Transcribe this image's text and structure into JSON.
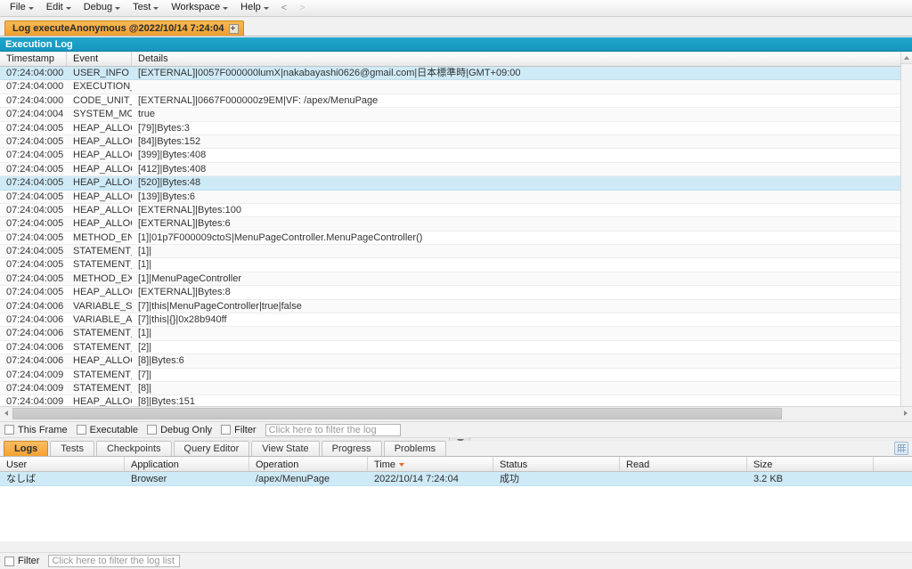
{
  "menubar": {
    "items": [
      {
        "label": "File",
        "caret": true
      },
      {
        "label": "Edit",
        "caret": true
      },
      {
        "label": "Debug",
        "caret": true
      },
      {
        "label": "Test",
        "caret": true
      },
      {
        "label": "Workspace",
        "caret": true
      },
      {
        "label": "Help",
        "caret": true
      }
    ],
    "nav_back": "<",
    "nav_forward": ">"
  },
  "doctab": {
    "label": "Log executeAnonymous @2022/10/14 7:24:04",
    "close_title": "Close"
  },
  "exec_panel": {
    "title": "Execution Log"
  },
  "log_grid": {
    "columns": [
      "Timestamp",
      "Event",
      "Details"
    ],
    "rows": [
      {
        "ts": "07:24:04:000",
        "ev": "USER_INFO",
        "de": "[EXTERNAL]|0057F000000lumX|nakabayashi0626@gmail.com|日本標準時|GMT+09:00",
        "sel": true
      },
      {
        "ts": "07:24:04:000",
        "ev": "EXECUTION_ST...",
        "de": ""
      },
      {
        "ts": "07:24:04:000",
        "ev": "CODE_UNIT_ST...",
        "de": "[EXTERNAL]|0667F000000z9EM|VF: /apex/MenuPage"
      },
      {
        "ts": "07:24:04:004",
        "ev": "SYSTEM_MODE...",
        "de": "true"
      },
      {
        "ts": "07:24:04:005",
        "ev": "HEAP_ALLOCATE",
        "de": "[79]|Bytes:3"
      },
      {
        "ts": "07:24:04:005",
        "ev": "HEAP_ALLOCATE",
        "de": "[84]|Bytes:152"
      },
      {
        "ts": "07:24:04:005",
        "ev": "HEAP_ALLOCATE",
        "de": "[399]|Bytes:408"
      },
      {
        "ts": "07:24:04:005",
        "ev": "HEAP_ALLOCATE",
        "de": "[412]|Bytes:408"
      },
      {
        "ts": "07:24:04:005",
        "ev": "HEAP_ALLOCATE",
        "de": "[520]|Bytes:48",
        "sel": true
      },
      {
        "ts": "07:24:04:005",
        "ev": "HEAP_ALLOCATE",
        "de": "[139]|Bytes:6"
      },
      {
        "ts": "07:24:04:005",
        "ev": "HEAP_ALLOCATE",
        "de": "[EXTERNAL]|Bytes:100"
      },
      {
        "ts": "07:24:04:005",
        "ev": "HEAP_ALLOCATE",
        "de": "[EXTERNAL]|Bytes:6"
      },
      {
        "ts": "07:24:04:005",
        "ev": "METHOD_ENTRY",
        "de": "[1]|01p7F000009ctoS|MenuPageController.MenuPageController()"
      },
      {
        "ts": "07:24:04:005",
        "ev": "STATEMENT_EX...",
        "de": "[1]|"
      },
      {
        "ts": "07:24:04:005",
        "ev": "STATEMENT_EX...",
        "de": "[1]|"
      },
      {
        "ts": "07:24:04:005",
        "ev": "METHOD_EXIT",
        "de": "[1]|MenuPageController"
      },
      {
        "ts": "07:24:04:005",
        "ev": "HEAP_ALLOCATE",
        "de": "[EXTERNAL]|Bytes:8"
      },
      {
        "ts": "07:24:04:006",
        "ev": "VARIABLE_SCO...",
        "de": "[7]|this|MenuPageController|true|false"
      },
      {
        "ts": "07:24:04:006",
        "ev": "VARIABLE_ASSI...",
        "de": "[7]|this|{}|0x28b940ff"
      },
      {
        "ts": "07:24:04:006",
        "ev": "STATEMENT_EX...",
        "de": "[1]|"
      },
      {
        "ts": "07:24:04:006",
        "ev": "STATEMENT_EX...",
        "de": "[2]|"
      },
      {
        "ts": "07:24:04:006",
        "ev": "HEAP_ALLOCATE",
        "de": "[8]|Bytes:6"
      },
      {
        "ts": "07:24:04:009",
        "ev": "STATEMENT_EX...",
        "de": "[7]|"
      },
      {
        "ts": "07:24:04:009",
        "ev": "STATEMENT_EX...",
        "de": "[8]|"
      },
      {
        "ts": "07:24:04:009",
        "ev": "HEAP_ALLOCATE",
        "de": "[8]|Bytes:151"
      }
    ]
  },
  "filterbar": {
    "checkboxes": [
      {
        "label": "This Frame",
        "checked": false
      },
      {
        "label": "Executable",
        "checked": false
      },
      {
        "label": "Debug Only",
        "checked": false
      },
      {
        "label": "Filter",
        "checked": false
      }
    ],
    "input_placeholder": "Click here to filter the log",
    "input_value": ""
  },
  "bottom_tabs": {
    "items": [
      {
        "label": "Logs",
        "active": true
      },
      {
        "label": "Tests",
        "active": false
      },
      {
        "label": "Checkpoints",
        "active": false
      },
      {
        "label": "Query Editor",
        "active": false
      },
      {
        "label": "View State",
        "active": false
      },
      {
        "label": "Progress",
        "active": false
      },
      {
        "label": "Problems",
        "active": false
      }
    ],
    "tool_icon": "grid-icon"
  },
  "log_list": {
    "columns": [
      {
        "label": "User",
        "sorted": false
      },
      {
        "label": "Application",
        "sorted": false
      },
      {
        "label": "Operation",
        "sorted": false
      },
      {
        "label": "Time",
        "sorted": true
      },
      {
        "label": "Status",
        "sorted": false
      },
      {
        "label": "Read",
        "sorted": false
      },
      {
        "label": "Size",
        "sorted": false
      }
    ],
    "rows": [
      {
        "user": "なしば",
        "application": "Browser",
        "operation": "/apex/MenuPage",
        "time": "2022/10/14 7:24:04",
        "status": "成功",
        "read": "",
        "size": "3.2 KB",
        "selected": true
      }
    ]
  },
  "bottom_filter": {
    "checkbox_label": "Filter",
    "checked": false,
    "input_placeholder": "Click here to filter the log list",
    "input_value": ""
  },
  "colors": {
    "accent_tab": "#f4a131",
    "panel_header": "#1a9ec5",
    "selection": "#cfeaf7",
    "sort_caret": "#e06c2a"
  }
}
